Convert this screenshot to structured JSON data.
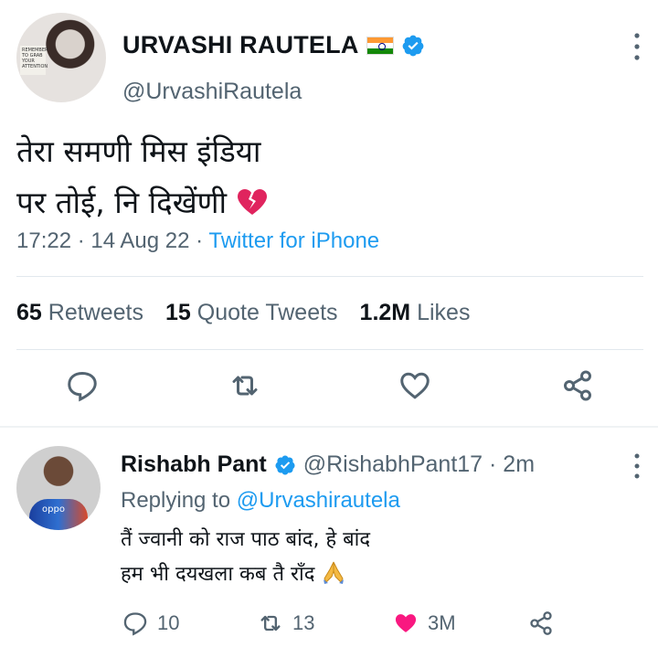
{
  "tweet": {
    "display_name": "URVASHI RAUTELA",
    "handle": "@UrvashiRautela",
    "avatar_badge_text": "REMEMBER TO GRAB YOUR ATTENTION",
    "text_lines": [
      "तेरा समणी मिस इंडिया",
      "पर तोई, नि दिखेंणी"
    ],
    "time": "17:22 · 14 Aug 22 · ",
    "source": "Twitter for iPhone",
    "stats": {
      "retweets_count": "65",
      "retweets_label": "Retweets",
      "quotes_count": "15",
      "quotes_label": "Quote Tweets",
      "likes_count": "1.2M",
      "likes_label": "Likes"
    }
  },
  "reply": {
    "display_name": "Rishabh Pant",
    "handle_time": "@RishabhPant17 · 2m",
    "replying_prefix": "Replying to ",
    "replying_mention": "@Urvashirautela",
    "text_lines": [
      "तैं ज्वानी को राज पाठ बांद, हे बांद",
      "हम भी दयखला कब तै राँद"
    ],
    "jersey_text": "oppo",
    "actions": {
      "reply_count": "10",
      "retweet_count": "13",
      "like_count": "3M"
    }
  },
  "colors": {
    "accent": "#1d9bf0",
    "muted": "#536471",
    "like_red": "#f91880"
  },
  "icons": [
    "india-flag-icon",
    "verified-icon",
    "more-vertical-icon",
    "broken-heart-icon",
    "reply-icon",
    "retweet-icon",
    "like-icon",
    "share-icon",
    "pray-icon"
  ]
}
